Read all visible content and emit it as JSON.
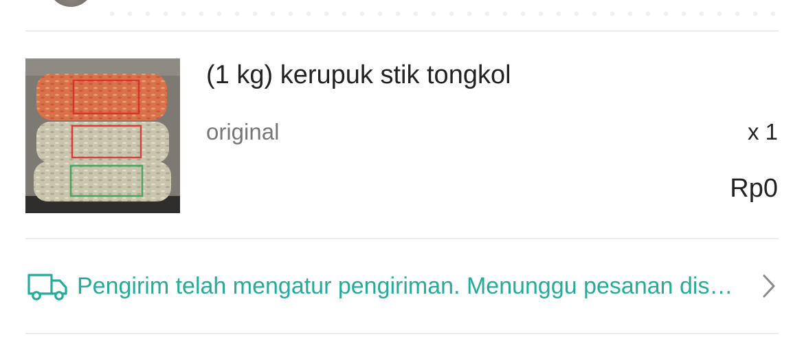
{
  "product": {
    "title": "(1 kg) kerupuk stik tongkol",
    "variation": "original",
    "quantity": "x 1",
    "price": "Rp0",
    "image_icon": "product-photo"
  },
  "shipping": {
    "status_text": "Pengirim telah mengatur pengiriman. Menunggu pesanan diserahkan ke pihak jasa kirim.",
    "icon": "truck-icon",
    "accent_color": "#26aa99"
  }
}
